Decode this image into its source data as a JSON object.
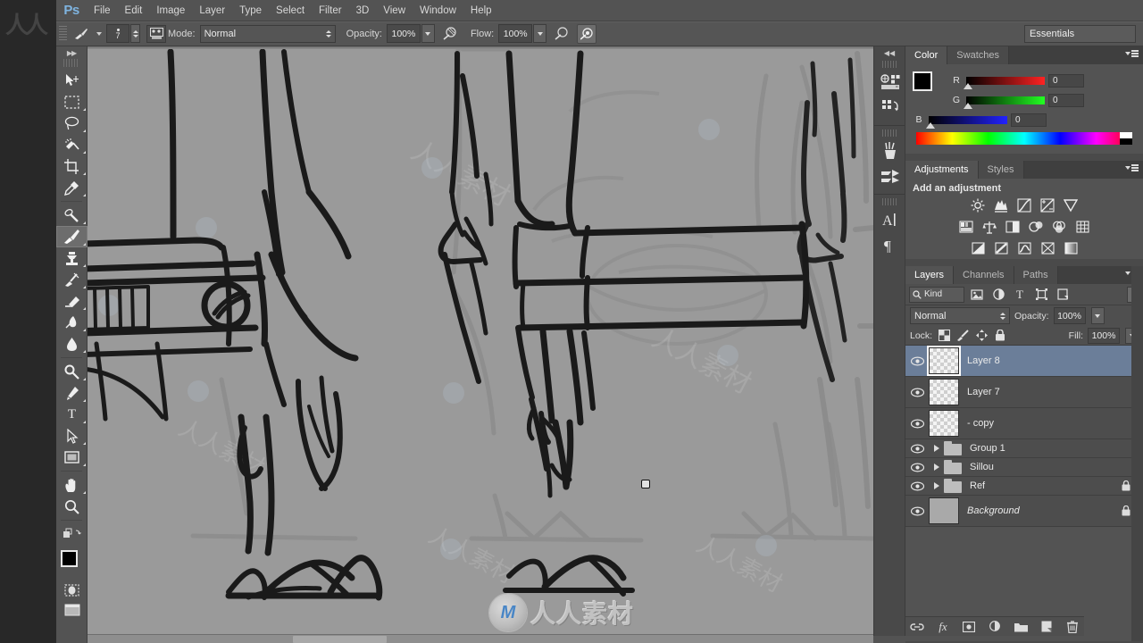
{
  "app": {
    "name": "Ps",
    "logo_color": "#7fb4e0"
  },
  "menubar": {
    "items": [
      {
        "label": "File"
      },
      {
        "label": "Edit"
      },
      {
        "label": "Image"
      },
      {
        "label": "Layer"
      },
      {
        "label": "Type"
      },
      {
        "label": "Select"
      },
      {
        "label": "Filter"
      },
      {
        "label": "3D"
      },
      {
        "label": "View"
      },
      {
        "label": "Window"
      },
      {
        "label": "Help"
      }
    ]
  },
  "options_bar": {
    "brush_size": "7",
    "mode_label": "Mode:",
    "mode_value": "Normal",
    "opacity_label": "Opacity:",
    "opacity_value": "100%",
    "flow_label": "Flow:",
    "flow_value": "100%",
    "workspace": "Essentials"
  },
  "toolbar": {
    "tools": [
      {
        "name": "move-tool",
        "active": false
      },
      {
        "name": "marquee-tool",
        "active": false
      },
      {
        "name": "lasso-tool",
        "active": false
      },
      {
        "name": "quick-selection-tool",
        "active": false
      },
      {
        "name": "crop-tool",
        "active": false
      },
      {
        "name": "eyedropper-tool",
        "active": false
      },
      {
        "name": "healing-brush-tool",
        "active": false
      },
      {
        "name": "brush-tool",
        "active": true
      },
      {
        "name": "clone-stamp-tool",
        "active": false
      },
      {
        "name": "history-brush-tool",
        "active": false
      },
      {
        "name": "eraser-tool",
        "active": false
      },
      {
        "name": "gradient-tool",
        "active": false
      },
      {
        "name": "blur-tool",
        "active": false
      },
      {
        "name": "dodge-tool",
        "active": false
      },
      {
        "name": "pen-tool",
        "active": false
      },
      {
        "name": "type-tool",
        "active": false
      },
      {
        "name": "path-selection-tool",
        "active": false
      },
      {
        "name": "rectangle-tool",
        "active": false
      },
      {
        "name": "hand-tool",
        "active": false
      },
      {
        "name": "zoom-tool",
        "active": false
      }
    ],
    "foreground_color": "#000000",
    "background_color": "#ffffff"
  },
  "color_panel": {
    "tabs": [
      {
        "label": "Color",
        "active": true
      },
      {
        "label": "Swatches",
        "active": false
      }
    ],
    "channels": [
      {
        "label": "R",
        "value": "0"
      },
      {
        "label": "G",
        "value": "0"
      },
      {
        "label": "B",
        "value": "0"
      }
    ]
  },
  "adjustments_panel": {
    "tabs": [
      {
        "label": "Adjustments",
        "active": true
      },
      {
        "label": "Styles",
        "active": false
      }
    ],
    "title": "Add an adjustment",
    "rows": [
      [
        "brightness-contrast-icon",
        "levels-icon",
        "curves-icon",
        "exposure-icon",
        "vibrance-icon"
      ],
      [
        "hue-saturation-icon",
        "color-balance-icon",
        "black-white-icon",
        "photo-filter-icon",
        "channel-mixer-icon",
        "color-lookup-icon"
      ],
      [
        "invert-icon",
        "posterize-icon",
        "threshold-icon",
        "selective-color-icon",
        "gradient-map-icon"
      ]
    ]
  },
  "layers_panel": {
    "tabs": [
      {
        "label": "Layers",
        "active": true
      },
      {
        "label": "Channels",
        "active": false
      },
      {
        "label": "Paths",
        "active": false
      }
    ],
    "filter_kind": "Kind",
    "blend_mode": "Normal",
    "opacity_label": "Opacity:",
    "opacity_value": "100%",
    "lock_label": "Lock:",
    "fill_label": "Fill:",
    "fill_value": "100%",
    "layers": [
      {
        "name": "Layer 8",
        "type": "raster",
        "selected": true,
        "visible": true,
        "locked": false,
        "italic": false
      },
      {
        "name": "Layer 7",
        "type": "raster",
        "selected": false,
        "visible": true,
        "locked": false,
        "italic": false
      },
      {
        "name": "- copy",
        "type": "raster",
        "selected": false,
        "visible": true,
        "locked": false,
        "italic": false
      },
      {
        "name": "Group 1",
        "type": "group",
        "selected": false,
        "visible": true,
        "locked": false,
        "italic": false
      },
      {
        "name": "Sillou",
        "type": "group",
        "selected": false,
        "visible": true,
        "locked": false,
        "italic": false
      },
      {
        "name": "Ref",
        "type": "group",
        "selected": false,
        "visible": true,
        "locked": true,
        "italic": false
      },
      {
        "name": "Background",
        "type": "background",
        "selected": false,
        "visible": true,
        "locked": true,
        "italic": true
      }
    ],
    "bottom_buttons": [
      "link-layers-icon",
      "layer-style-fx-icon",
      "add-mask-icon",
      "new-adjustment-layer-icon",
      "new-group-icon",
      "new-layer-icon",
      "delete-layer-icon"
    ]
  },
  "icon_dock": {
    "buttons": [
      "mini-bridge-icon",
      "history-icon",
      "brush-presets-icon",
      "tool-presets-icon",
      "character-icon",
      "paragraph-icon"
    ]
  },
  "watermark": {
    "logo_letter": "M",
    "text": "人人素材"
  },
  "canvas": {
    "background_color": "#9a9a9a",
    "ink_color": "#1a1a1a",
    "ghost_color": "#8d8d8d",
    "description": "character-sketch-legs-and-feet"
  }
}
